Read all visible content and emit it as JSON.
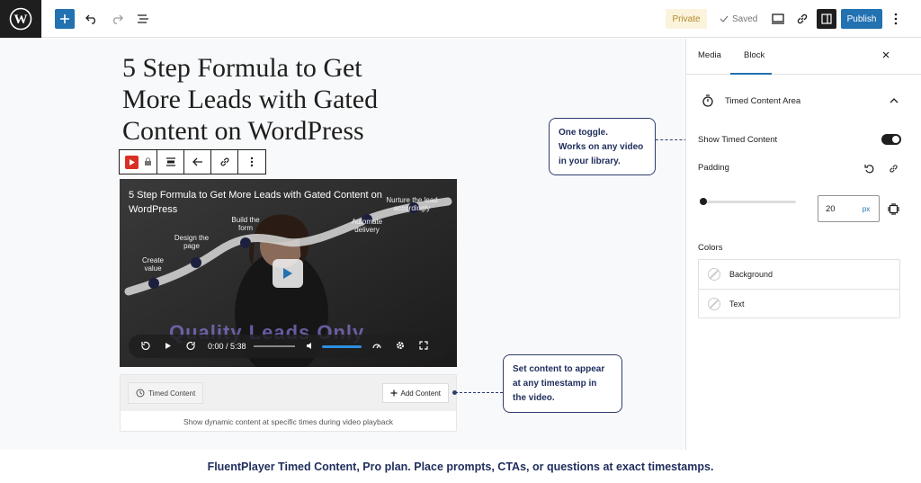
{
  "toolbar": {
    "add_icon": "plus-icon",
    "private_label": "Private",
    "saved_label": "Saved",
    "publish_label": "Publish"
  },
  "post": {
    "title": "5 Step Formula to Get More Leads with Gated Content on WordPress"
  },
  "video": {
    "title": "5 Step Formula to Get More Leads with Gated Content on WordPress",
    "step_labels": [
      "Create value",
      "Design the page",
      "Build the form",
      "Automate delivery",
      "Nurture the lead accordingly"
    ],
    "watermark": "Quality Leads Only",
    "time": "0:00 / 5:38"
  },
  "timed_content": {
    "tab_label": "Timed Content",
    "add_label": "Add Content",
    "description": "Show dynamic content at specific times during video playback"
  },
  "callouts": {
    "top": [
      "One toggle.",
      "Works on any video",
      "in your library."
    ],
    "bottom": [
      "Set content to appear",
      "at any timestamp in",
      "the video."
    ]
  },
  "sidebar": {
    "tabs": [
      "Media",
      "Block"
    ],
    "panel_title": "Timed Content Area",
    "show_label": "Show Timed Content",
    "show_enabled": true,
    "padding_label": "Padding",
    "padding_value": "20",
    "padding_unit": "px",
    "padding_slider_fraction": 0.0,
    "colors_label": "Colors",
    "colors": [
      "Background",
      "Text"
    ]
  },
  "footer": {
    "text": "FluentPlayer Timed Content, Pro plan. Place prompts, CTAs, or questions at exact timestamps."
  },
  "colors": {
    "accent": "#2271b1",
    "callout_navy": "#1f2d5c",
    "private_bg": "#fcf3dc"
  }
}
